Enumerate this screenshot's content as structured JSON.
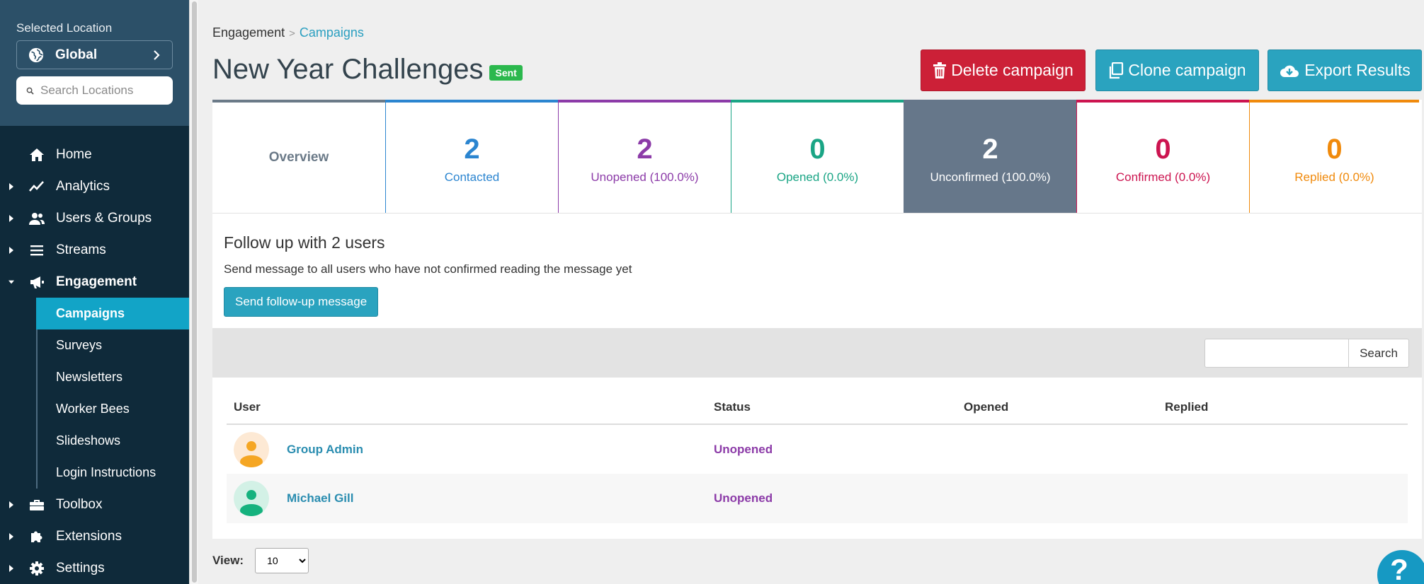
{
  "sidebar": {
    "selected_label": "Selected Location",
    "location": "Global",
    "search_placeholder": "Search Locations",
    "nav": [
      {
        "label": "Home",
        "icon": "home-icon"
      },
      {
        "label": "Analytics",
        "icon": "analytics-icon"
      },
      {
        "label": "Users & Groups",
        "icon": "users-icon"
      },
      {
        "label": "Streams",
        "icon": "streams-icon"
      },
      {
        "label": "Engagement",
        "icon": "megaphone-icon"
      },
      {
        "label": "Toolbox",
        "icon": "toolbox-icon"
      },
      {
        "label": "Extensions",
        "icon": "puzzle-icon"
      },
      {
        "label": "Settings",
        "icon": "gear-icon"
      }
    ],
    "sub": [
      "Campaigns",
      "Surveys",
      "Newsletters",
      "Worker Bees",
      "Slideshows",
      "Login Instructions"
    ]
  },
  "breadcrumb": {
    "root": "Engagement",
    "separator": ">",
    "current": "Campaigns"
  },
  "page": {
    "title": "New Year Challenges",
    "badge": "Sent"
  },
  "actions": {
    "delete": "Delete campaign",
    "clone": "Clone campaign",
    "export": "Export Results"
  },
  "stats": {
    "overview": "Overview",
    "contacted": {
      "num": "2",
      "label": "Contacted"
    },
    "unopened": {
      "num": "2",
      "label": "Unopened (100.0%)"
    },
    "opened": {
      "num": "0",
      "label": "Opened (0.0%)"
    },
    "unconfirmed": {
      "num": "2",
      "label": "Unconfirmed (100.0%)"
    },
    "confirmed": {
      "num": "0",
      "label": "Confirmed (0.0%)"
    },
    "replied": {
      "num": "0",
      "label": "Replied (0.0%)"
    }
  },
  "followup": {
    "title": "Follow up with 2 users",
    "desc": "Send message to all users who have not confirmed reading the message yet",
    "button": "Send follow-up message"
  },
  "search": {
    "button": "Search"
  },
  "table": {
    "headers": {
      "user": "User",
      "status": "Status",
      "opened": "Opened",
      "replied": "Replied"
    },
    "rows": [
      {
        "name": "Group Admin",
        "status": "Unopened",
        "opened": "",
        "replied": "",
        "avatar_color": "#f5a623"
      },
      {
        "name": "Michael Gill",
        "status": "Unopened",
        "opened": "",
        "replied": "",
        "avatar_color": "#15b27e"
      }
    ]
  },
  "view": {
    "label": "View:",
    "value": "10",
    "options": [
      "10"
    ]
  },
  "help": {
    "label": "?"
  },
  "colors": {
    "sidebar_bg": "#0f2a3a",
    "sidebar_top": "#2c5068",
    "accent": "#12a4c7",
    "delete": "#cc2037",
    "contacted": "#2b85d0",
    "unopened": "#8c3ba8",
    "opened": "#1aa585",
    "unconfirmed": "#66778a",
    "confirmed": "#cc1450",
    "replied": "#f08a0c"
  }
}
